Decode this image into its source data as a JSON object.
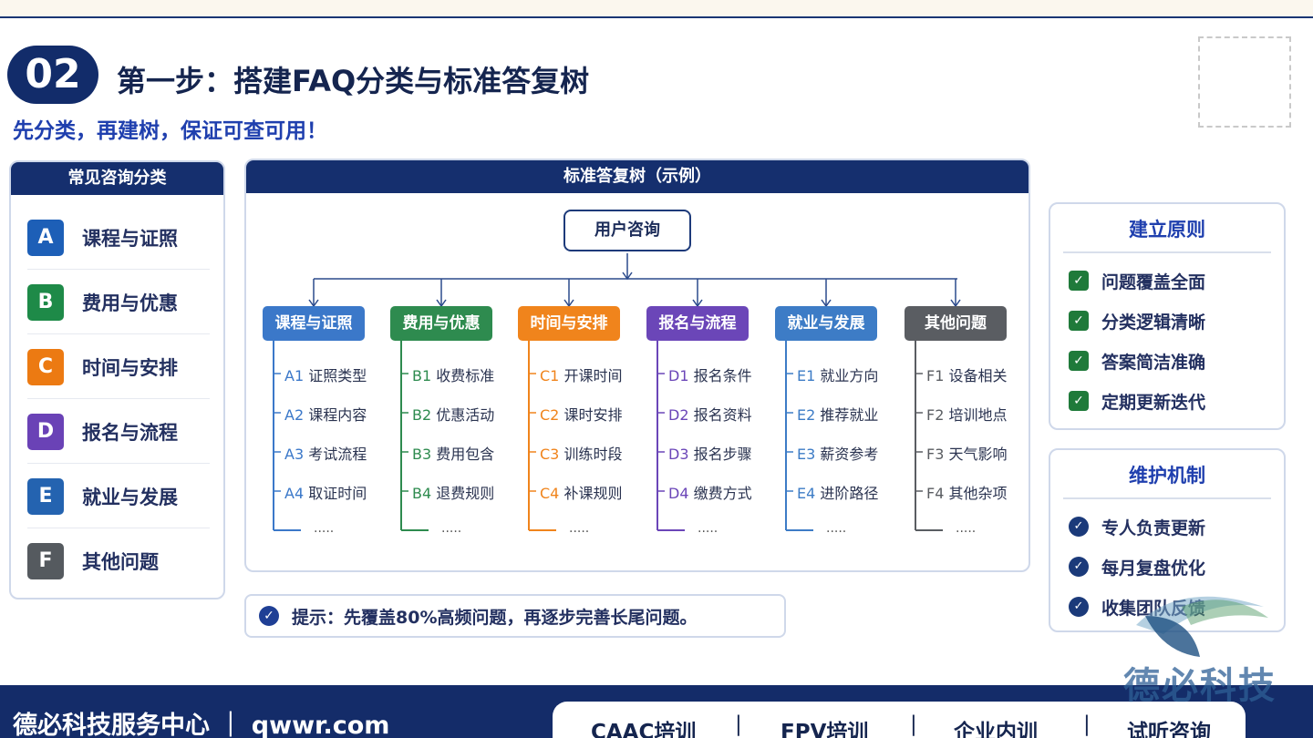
{
  "header": {
    "step_number": "02",
    "title": "第一步：搭建FAQ分类与标准答复树",
    "subtitle": "先分类，再建树，保证可查可用！"
  },
  "categories": {
    "title": "常见咨询分类",
    "items": [
      {
        "letter": "A",
        "label": "课程与证照",
        "color": "#1d5fb7"
      },
      {
        "letter": "B",
        "label": "费用与优惠",
        "color": "#1e8a48"
      },
      {
        "letter": "C",
        "label": "时间与安排",
        "color": "#ec7a12"
      },
      {
        "letter": "D",
        "label": "报名与流程",
        "color": "#6a42b6"
      },
      {
        "letter": "E",
        "label": "就业与发展",
        "color": "#2463b0"
      },
      {
        "letter": "F",
        "label": "其他问题",
        "color": "#555a5f"
      }
    ]
  },
  "tree": {
    "title": "标准答复树（示例）",
    "root": "用户咨询",
    "branches": [
      {
        "label": "课程与证照",
        "color": "#3b78c9",
        "leaves": [
          {
            "code": "A1",
            "text": "证照类型"
          },
          {
            "code": "A2",
            "text": "课程内容"
          },
          {
            "code": "A3",
            "text": "考试流程"
          },
          {
            "code": "A4",
            "text": "取证时间"
          }
        ],
        "more": "....."
      },
      {
        "label": "费用与优惠",
        "color": "#2e8b4f",
        "leaves": [
          {
            "code": "B1",
            "text": "收费标准"
          },
          {
            "code": "B2",
            "text": "优惠活动"
          },
          {
            "code": "B3",
            "text": "费用包含"
          },
          {
            "code": "B4",
            "text": "退费规则"
          }
        ],
        "more": "....."
      },
      {
        "label": "时间与安排",
        "color": "#f0841c",
        "leaves": [
          {
            "code": "C1",
            "text": "开课时间"
          },
          {
            "code": "C2",
            "text": "课时安排"
          },
          {
            "code": "C3",
            "text": "训练时段"
          },
          {
            "code": "C4",
            "text": "补课规则"
          }
        ],
        "more": "....."
      },
      {
        "label": "报名与流程",
        "color": "#6b46b8",
        "leaves": [
          {
            "code": "D1",
            "text": "报名条件"
          },
          {
            "code": "D2",
            "text": "报名资料"
          },
          {
            "code": "D3",
            "text": "报名步骤"
          },
          {
            "code": "D4",
            "text": "缴费方式"
          }
        ],
        "more": "....."
      },
      {
        "label": "就业与发展",
        "color": "#3d7cc6",
        "leaves": [
          {
            "code": "E1",
            "text": "就业方向"
          },
          {
            "code": "E2",
            "text": "推荐就业"
          },
          {
            "code": "E3",
            "text": "薪资参考"
          },
          {
            "code": "E4",
            "text": "进阶路径"
          }
        ],
        "more": "....."
      },
      {
        "label": "其他问题",
        "color": "#5a5d62",
        "leaves": [
          {
            "code": "F1",
            "text": "设备相关"
          },
          {
            "code": "F2",
            "text": "培训地点"
          },
          {
            "code": "F3",
            "text": "天气影响"
          },
          {
            "code": "F4",
            "text": "其他杂项"
          }
        ],
        "more": "....."
      }
    ]
  },
  "tip": {
    "icon": "check-badge-icon",
    "text": "提示：先覆盖80%高频问题，再逐步完善长尾问题。"
  },
  "principles": {
    "title": "建立原则",
    "items": [
      "问题覆盖全面",
      "分类逻辑清晰",
      "答案简洁准确",
      "定期更新迭代"
    ]
  },
  "maintenance": {
    "title": "维护机制",
    "items": [
      "专人负责更新",
      "每月复盘优化",
      "收集团队反馈"
    ]
  },
  "footer": {
    "brand": "德必科技服务中心 ｜ qwwr.com",
    "links": [
      "CAAC培训",
      "FPV培训",
      "企业内训",
      "试听咨询"
    ],
    "separator": "|"
  },
  "watermark": {
    "text": "德必科技"
  }
}
